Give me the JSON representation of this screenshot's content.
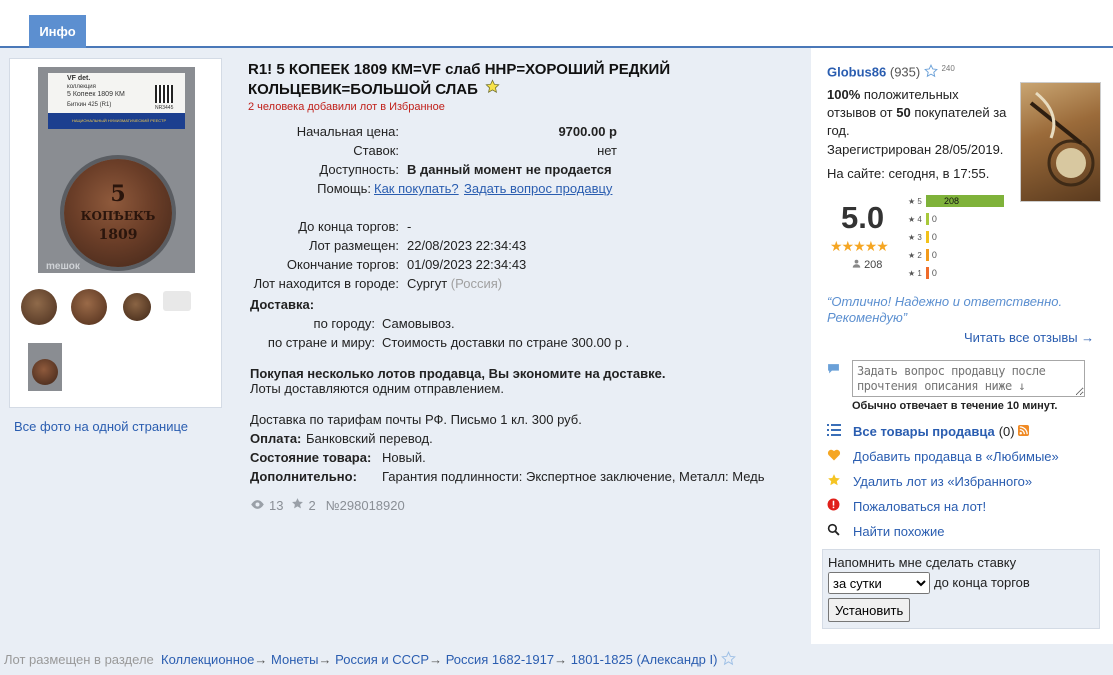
{
  "tabs": [
    {
      "label": "Инфо"
    }
  ],
  "photos": {
    "label_lines": [
      "VF det.",
      "коллекция",
      "5 Копеек 1809 КМ",
      "Биткин 425 (R1)"
    ],
    "label_code": "NR3445",
    "brand_band": "НАЦИОНАЛЬНЫЙ НУМИЗМАТИЧЕСКИЙ РЕЕСТР",
    "coin_text": [
      "5",
      "КОПѢЕКЪ",
      "1809"
    ],
    "watermark": "meшок",
    "all_photos_link": "Все фото на одной странице"
  },
  "lot": {
    "title": "R1! 5 КОПЕЕК 1809 КМ=VF слаб ННР=ХОРОШИЙ РЕДКИЙ КОЛЬЦЕВИК=БОЛЬШОЙ СЛАБ",
    "favorites_note": "2 человека добавили лот в Избранное",
    "start_price_label": "Начальная цена:",
    "start_price": "9700.00 р",
    "bids_label": "Ставок:",
    "bids": "нет",
    "availability_label": "Доступность:",
    "availability": "В данный момент не продается",
    "help_label": "Помощь:",
    "help_how": "Как покупать?",
    "help_ask": "Задать вопрос продавцу",
    "ends_in_label": "До конца торгов:",
    "ends_in": "-",
    "placed_label": "Лот размещен:",
    "placed": "22/08/2023 22:34:43",
    "end_label": "Окончание торгов:",
    "end": "01/09/2023 22:34:43",
    "city_label": "Лот находится в городе:",
    "city": "Сургут",
    "country": "(Россия)",
    "delivery_label": "Доставка:",
    "delivery_city_label": "по городу:",
    "delivery_city": "Самовывоз.",
    "delivery_country_label": "по стране и миру:",
    "delivery_country": "Стоимость доставки по стране 300.00 р .",
    "multi_lot_bold": "Покупая несколько лотов продавца, Вы экономите на доставке.",
    "multi_lot_note": "Лоты доставляются одним отправлением.",
    "shipping_note": "Доставка по тарифам почты РФ. Письмо 1 кл. 300 руб.",
    "payment_label": "Оплата:",
    "payment": "Банковский перевод.",
    "condition_label": "Состояние товара:",
    "condition": "Новый.",
    "extra_label": "Дополнительно:",
    "extra": "Гарантия подлинности: Экспертное заключение, Металл: Медь",
    "views": "13",
    "favs": "2",
    "number": "№298018920"
  },
  "seller": {
    "name": "Globus86",
    "count": "(935)",
    "star_count": "240",
    "positive_pct": "100%",
    "positive_text_1": " положительных",
    "positive_text_2": "отзывов от ",
    "positive_buyers": "50",
    "positive_text_3": " покупателей за",
    "positive_text_4": "год.",
    "registered": "Зарегистрирован 28/05/2019.",
    "online": "На сайте: сегодня, в 17:55.",
    "rating": "5.0",
    "stars": "★★★★★",
    "reviews_count": "208",
    "distribution": [
      {
        "star": "5",
        "value": 208,
        "color": "#7fb23a"
      },
      {
        "star": "4",
        "value": 0,
        "color": "#a8c83a"
      },
      {
        "star": "3",
        "value": 0,
        "color": "#f2c21a"
      },
      {
        "star": "2",
        "value": 0,
        "color": "#f29a1a"
      },
      {
        "star": "1",
        "value": 0,
        "color": "#ef6b2a"
      }
    ],
    "quote": "“Отлично! Надежно и ответственно. Рекомендую”",
    "all_reviews": "Читать все отзывы →",
    "question_placeholder": "Задать вопрос продавцу после прочтения описания ниже ↓",
    "reply_note": "Обычно отвечает в течение 10 минут."
  },
  "actions": {
    "all_goods": "Все товары продавца",
    "all_goods_count": "(0)",
    "add_fav": "Добавить продавца в «Любимые»",
    "remove_fav": "Удалить лот из «Избранного»",
    "complain": "Пожаловаться на лот!",
    "similar": "Найти похожие"
  },
  "remind": {
    "title": "Напомнить мне сделать ставку",
    "selected": "за сутки",
    "suffix": "до конца торгов",
    "button": "Установить"
  },
  "breadcrumbs": {
    "prefix": "Лот размещен в разделе",
    "items": [
      "Коллекционное",
      "Монеты",
      "Россия и СССР",
      "Россия 1682-1917",
      "1801-1825 (Александр I)"
    ]
  },
  "colors": {
    "accent": "#2a5db0",
    "tab": "#5c8fd0",
    "panel": "#e9eef5",
    "alert": "#c0201a"
  }
}
